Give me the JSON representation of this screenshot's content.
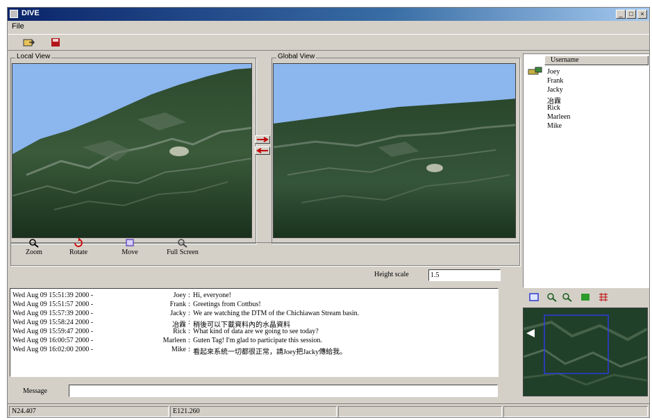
{
  "window": {
    "title": "DIVE",
    "minimize_glyph": "_",
    "maximize_glyph": "□",
    "close_glyph": "×"
  },
  "menu": {
    "file_label": "File"
  },
  "toolbar": {
    "icons": [
      "folder-icon",
      "save-icon"
    ]
  },
  "views": {
    "local_label": "Local View",
    "global_label": "Global View"
  },
  "tools": {
    "zoom_label": "Zoom",
    "rotate_label": "Rotate",
    "move_label": "Move",
    "fullscreen_label": "Full Screen"
  },
  "users": {
    "header": "Username",
    "items": [
      "Joey",
      "Frank",
      "Jacky",
      "冶霖",
      "Rick",
      "Marleen",
      "Mike"
    ]
  },
  "height_scale": {
    "label": "Height scale",
    "value": "1.5"
  },
  "chat": {
    "messages": [
      {
        "time": "Wed Aug 09 15:51:39 2000 -",
        "user": "Joey",
        "text": "Hi, everyone!"
      },
      {
        "time": "Wed Aug 09 15:51:57 2000 -",
        "user": "Frank",
        "text": "Greetings from Cottbus!"
      },
      {
        "time": "Wed Aug 09 15:57:39 2000 -",
        "user": "Jacky",
        "text": "We are watching the DTM of the Chichiawan Stream basin."
      },
      {
        "time": "Wed Aug 09 15:58:24 2000 -",
        "user": "冶霖",
        "text": "稍後可以下載資料內的水晶資料"
      },
      {
        "time": "Wed Aug 09 15:59:47 2000 -",
        "user": "Rick",
        "text": "What kind of data are we going to see today?"
      },
      {
        "time": "Wed Aug 09 16:00:57 2000 -",
        "user": "Marleen",
        "text": "Guten Tag! I'm glad to participate this session."
      },
      {
        "time": "Wed Aug 09 16:02:00 2000 -",
        "user": "Mike",
        "text": "看起來系統一切都很正常，請Joey把Jacky傳給我。"
      }
    ]
  },
  "message": {
    "label": "Message",
    "value": ""
  },
  "status": {
    "lat": "N24.407",
    "lon": "E121.260"
  },
  "colors": {
    "title_bar": "#0a246a",
    "window_bg": "#d4d0c8",
    "sky": "#8cb6ee"
  }
}
